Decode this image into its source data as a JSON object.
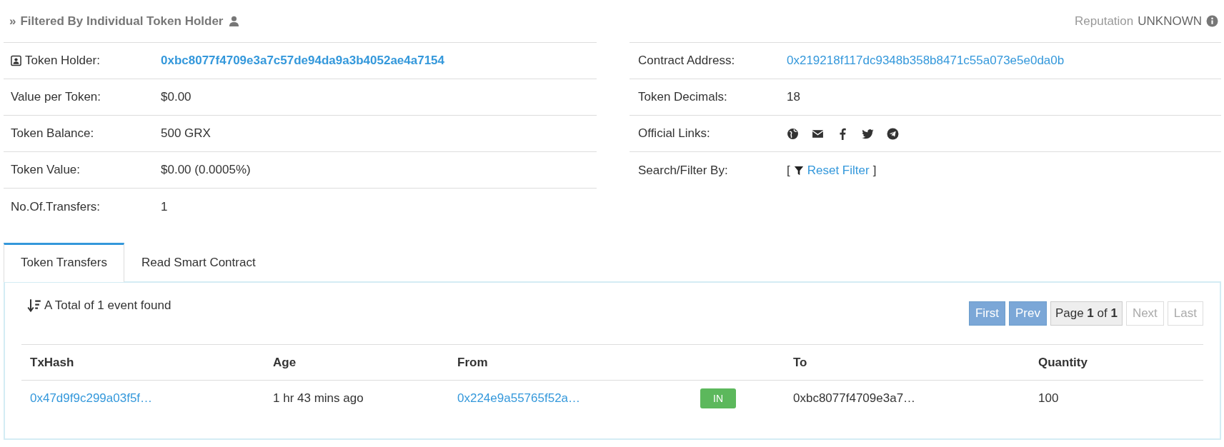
{
  "filter_heading": {
    "prefix": "»",
    "text": "Filtered By Individual Token Holder"
  },
  "reputation": {
    "label": "Reputation",
    "value": "UNKNOWN"
  },
  "left_rows": [
    {
      "label": "Token Holder:",
      "value": "0xbc8077f4709e3a7c57de94da9a3b4052ae4a7154",
      "kind": "bold_link",
      "label_icon": true
    },
    {
      "label": "Value per Token:",
      "value": "$0.00",
      "kind": "text",
      "label_icon": false
    },
    {
      "label": "Token Balance:",
      "value": "500 GRX",
      "kind": "text",
      "label_icon": false
    },
    {
      "label": "Token Value:",
      "value": "$0.00 (0.0005%)",
      "kind": "text",
      "label_icon": false
    },
    {
      "label": "No.Of.Transfers:",
      "value": "1",
      "kind": "text",
      "label_icon": false
    }
  ],
  "right_rows": [
    {
      "label": "Contract Address:",
      "value": "0x219218f117dc9348b358b8471c55a073e5e0da0b",
      "kind": "link"
    },
    {
      "label": "Token Decimals:",
      "value": "18",
      "kind": "text"
    },
    {
      "label": "Official Links:",
      "kind": "icons"
    },
    {
      "label": "Search/Filter By:",
      "kind": "filter",
      "open": "[",
      "value": "Reset Filter",
      "close": "]"
    }
  ],
  "tabs": [
    {
      "label": "Token Transfers",
      "selected": true
    },
    {
      "label": "Read Smart Contract",
      "selected": false
    }
  ],
  "summary": "A Total of 1 event found",
  "pager": [
    {
      "kind": "button",
      "label": "First",
      "disabled": false
    },
    {
      "kind": "button",
      "label": "Prev",
      "disabled": false
    },
    {
      "kind": "current",
      "label": "Page **1** of **1**"
    },
    {
      "kind": "button",
      "label": "Next",
      "disabled": true
    },
    {
      "kind": "button",
      "label": "Last",
      "disabled": true
    }
  ],
  "table": {
    "columns": [
      "TxHash",
      "Age",
      "From",
      "To",
      "Quantity"
    ],
    "rows": [
      {
        "txhash": "0x47d9f9c299a03f5f…",
        "age": "1 hr 43 mins ago",
        "from": "0x224e9a55765f52a…",
        "direction": "IN",
        "to": "0xbc8077f4709e3a7…",
        "quantity": "100"
      }
    ]
  }
}
